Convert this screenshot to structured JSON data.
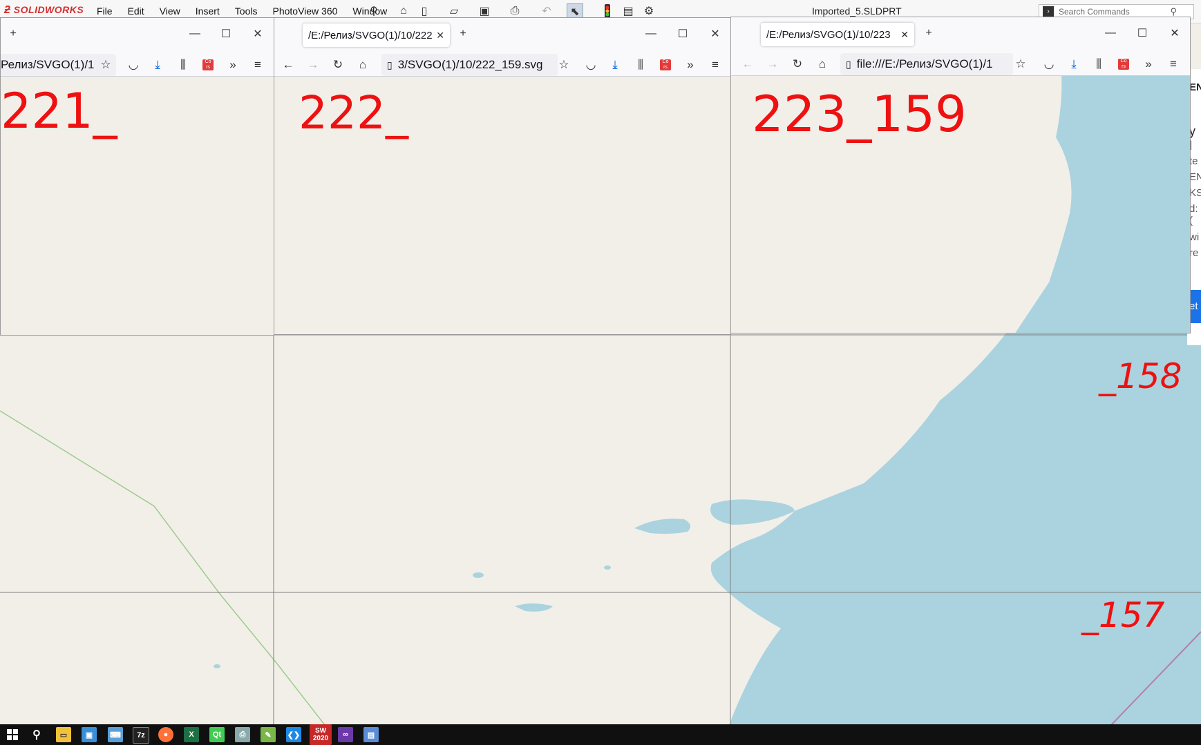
{
  "solidworks": {
    "logo": "SOLIDWORKS",
    "menu": [
      "File",
      "Edit",
      "View",
      "Insert",
      "Tools",
      "PhotoView 360",
      "Window"
    ],
    "document_title": "Imported_5.SLDPRT",
    "search_placeholder": "Search Commands"
  },
  "browsers": {
    "left": {
      "url": "Релиз/SVGO(1)/1",
      "handwritten": "221_"
    },
    "middle": {
      "tab_title": "/E:/Релиз/SVGO(1)/10/222",
      "url": "3/SVGO(1)/10/222_159.svg",
      "handwritten": "222_"
    },
    "right": {
      "tab_title": "/E:/Релиз/SVGO(1)/10/223",
      "url": "file:///E:/Релиз/SVGO(1)/1",
      "handwritten": "223_159"
    }
  },
  "map_labels": {
    "lower_158": "_158",
    "lower_157": "_157"
  },
  "right_edge_fragments": [
    "EN",
    "y l",
    "te",
    "EN",
    "KS",
    "d: (",
    "wi",
    "re",
    "et"
  ],
  "colors": {
    "land": "#f2efe9",
    "water": "#aad3df",
    "boundary_green": "#9ccc8c",
    "boundary_purple": "#b77fa8",
    "handwriting_red": "#ee1111",
    "accent_blue": "#0060df",
    "solidworks_red": "#d32f2f"
  },
  "taskbar": {
    "icons": [
      "start-icon",
      "search-icon",
      "file-explorer-icon",
      "network-icon",
      "keyboard-icon",
      "7zip-icon",
      "firefox-icon",
      "excel-icon",
      "qt-creator-icon",
      "printer-icon",
      "notepad-icon",
      "vscode-icon",
      "solidworks-icon",
      "visual-studio-icon",
      "document-icon"
    ],
    "solidworks_label": "2020"
  }
}
